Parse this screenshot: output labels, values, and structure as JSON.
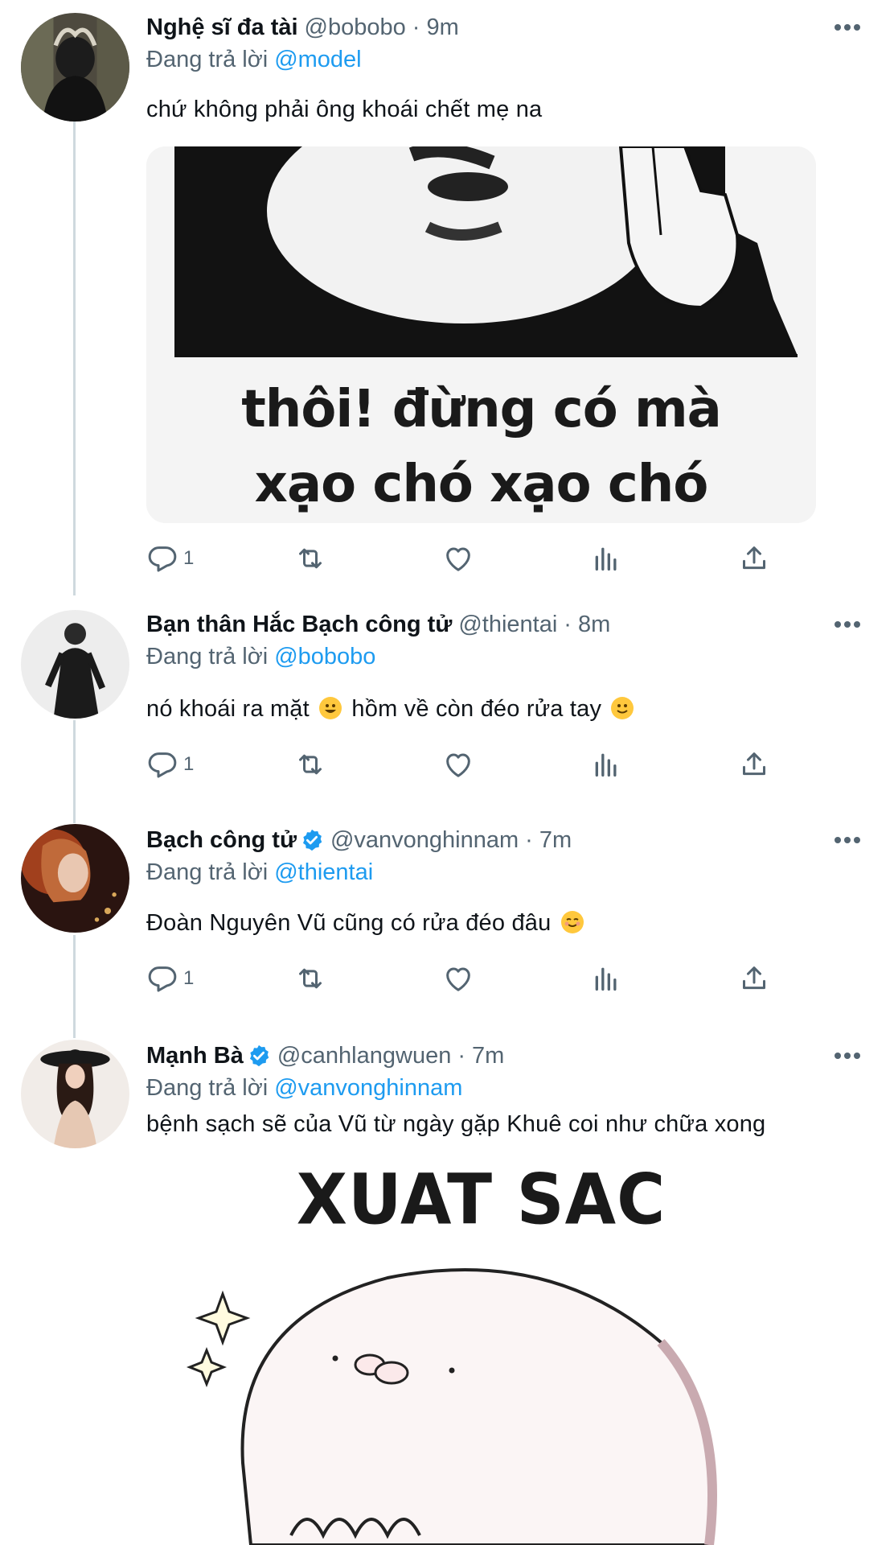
{
  "tweets": [
    {
      "name": "Nghệ sĩ đa tài",
      "handle": "@bobobo",
      "time": "9m",
      "replying_label": "Đang trả lời",
      "replying_to": "@model",
      "text": "chứ không phải ông khoái chết mẹ na",
      "media_caption": [
        "thôi! đừng có mà",
        "xạo chó xạo chó"
      ],
      "reply_count": "1",
      "verified": false
    },
    {
      "name": "Bạn thân Hắc Bạch công tử",
      "handle": "@thientai",
      "time": "8m",
      "replying_label": "Đang trả lời",
      "replying_to": "@bobobo",
      "text_before": "nó khoái ra mặt",
      "text_middle": "hồm về còn đéo rửa tay",
      "reply_count": "1",
      "verified": false
    },
    {
      "name": "Bạch công tử",
      "handle": "@vanvonghinnam",
      "time": "7m",
      "replying_label": "Đang trả lời",
      "replying_to": "@thientai",
      "text": "Đoàn Nguyên Vũ cũng có rửa đéo đâu",
      "reply_count": "1",
      "verified": true
    },
    {
      "name": "Mạnh Bà",
      "handle": "@canhlangwuen",
      "time": "7m",
      "replying_label": "Đang trả lời",
      "replying_to": "@vanvonghinnam",
      "text": "bệnh sạch sẽ của Vũ từ ngày gặp Khuê coi như chữa xong",
      "media_caption": [
        "XUAT SAC"
      ],
      "verified": true
    }
  ],
  "separator": "·",
  "icons": {
    "more": "more-horizontal-icon",
    "reply": "reply-icon",
    "retweet": "retweet-icon",
    "like": "heart-icon",
    "views": "analytics-icon",
    "share": "share-icon",
    "verified": "verified-badge-icon"
  },
  "colors": {
    "link": "#1d9bf0",
    "secondary_text": "#536471",
    "thread_line": "#cfd9de"
  }
}
